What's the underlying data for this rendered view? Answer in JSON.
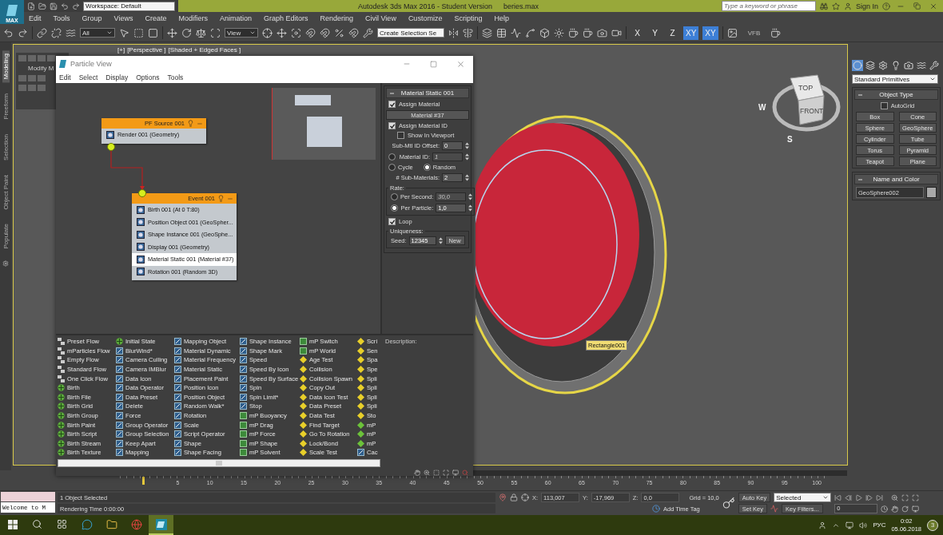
{
  "app": {
    "logo": "MAX",
    "workspace": "Workspace: Default",
    "title": "Autodesk 3ds Max 2016 - Student Version",
    "file": "beries.max",
    "search_placeholder": "Type a keyword or phrase",
    "sign_in": "Sign In"
  },
  "menu": [
    "Edit",
    "Tools",
    "Group",
    "Views",
    "Create",
    "Modifiers",
    "Animation",
    "Graph Editors",
    "Rendering",
    "Civil View",
    "Customize",
    "Scripting",
    "Help"
  ],
  "toolbar": {
    "selection_filter": "All",
    "reference_coordinate": "View",
    "named_selection": "Create Selection Se",
    "axes": [
      {
        "label": "X",
        "selected": false
      },
      {
        "label": "Y",
        "selected": false
      },
      {
        "label": "Z",
        "selected": false
      },
      {
        "label": "XY",
        "selected": true
      },
      {
        "label": "XY",
        "selected": true
      }
    ],
    "vfb": "VFB"
  },
  "ribbon_tabs": [
    {
      "label": "Modeling",
      "selected": true
    },
    {
      "label": "Freeform",
      "selected": false
    },
    {
      "label": "Selection",
      "selected": false
    },
    {
      "label": "Object Paint",
      "selected": false
    },
    {
      "label": "Populate",
      "selected": false
    }
  ],
  "viewport": {
    "active": true,
    "labels": [
      "[+]",
      "[Perspective ]",
      "[Shaded + Edged Faces ]"
    ],
    "mini_panel": "Modify M",
    "object_tag": "Rectangle001",
    "viewcube": {
      "top": "TOP",
      "front": "FRONT",
      "compass": [
        "W",
        "S"
      ]
    }
  },
  "particle_view": {
    "title": "Particle View",
    "menu": [
      "Edit",
      "Select",
      "Display",
      "Options",
      "Tools"
    ],
    "nodes": [
      {
        "title": "PF Source 001",
        "items": [
          {
            "label": "Render 001 (Geometry)",
            "selected": false
          }
        ]
      },
      {
        "title": "Event 001",
        "items": [
          {
            "label": "Birth 001 (At 0 T:80)",
            "selected": false
          },
          {
            "label": "Position Object 001 (GeoSpher...",
            "selected": false
          },
          {
            "label": "Shape Instance 001 (GeoSphe...",
            "selected": false
          },
          {
            "label": "Display 001 (Geometry)",
            "selected": false
          },
          {
            "label": "Material Static 001 (Material #37)",
            "selected": true
          },
          {
            "label": "Rotation 001 (Random 3D)",
            "selected": false
          }
        ]
      }
    ],
    "parameters": {
      "rollout": "Material Static 001",
      "rows": [
        {
          "kind": "checkbox",
          "label": "Assign Material",
          "checked": true
        },
        {
          "kind": "button",
          "label": "Material #37"
        },
        {
          "kind": "checkbox",
          "label": "Assign Material ID",
          "checked": true
        },
        {
          "kind": "subcheckbox",
          "label": "Show In Viewport",
          "checked": false
        },
        {
          "kind": "spinner",
          "label": "Sub-Mtl ID Offset:",
          "value": "0"
        },
        {
          "kind": "radio_spinner",
          "label": "Material ID:",
          "selected": false,
          "disabled": true,
          "value": "1"
        },
        {
          "kind": "radio_pair",
          "options": [
            {
              "label": "Cycle",
              "selected": false
            },
            {
              "label": "Random",
              "selected": true
            }
          ]
        },
        {
          "kind": "spinner",
          "label": "# Sub-Materials:",
          "value": "2"
        },
        {
          "kind": "group",
          "title": "Rate:",
          "rows": [
            {
              "kind": "radio_spinner",
              "label": "Per Second:",
              "selected": false,
              "disabled": true,
              "value": "30,0"
            },
            {
              "kind": "radio_spinner",
              "label": "Per Particle:",
              "selected": true,
              "disabled": false,
              "value": "1,0"
            }
          ]
        },
        {
          "kind": "checkbox",
          "label": "Loop",
          "checked": true
        },
        {
          "kind": "group",
          "title": "Uniqueness:",
          "rows": [
            {
              "kind": "seed",
              "label": "Seed:",
              "value": "12345",
              "button": "New"
            }
          ]
        }
      ]
    },
    "description_label": "Description:",
    "depot": [
      [
        {
          "label": "Preset Flow",
          "kind": "flow"
        },
        {
          "label": "mParticles Flow",
          "kind": "flow"
        },
        {
          "label": "Empty Flow",
          "kind": "flow"
        },
        {
          "label": "Standard Flow",
          "kind": "flow"
        },
        {
          "label": "One Click Flow",
          "kind": "flow"
        },
        {
          "label": "Birth",
          "kind": "birth"
        },
        {
          "label": "Birth File",
          "kind": "birth"
        },
        {
          "label": "Birth Grid",
          "kind": "birth"
        },
        {
          "label": "Birth Group",
          "kind": "birth"
        },
        {
          "label": "Birth Paint",
          "kind": "birth"
        },
        {
          "label": "Birth Script",
          "kind": "birth"
        },
        {
          "label": "Birth Stream",
          "kind": "birth"
        },
        {
          "label": "Birth Texture",
          "kind": "birth"
        }
      ],
      [
        {
          "label": "Initial State",
          "kind": "birth"
        },
        {
          "label": "BlurWind*",
          "kind": "operator"
        },
        {
          "label": "Camera Culling",
          "kind": "operator"
        },
        {
          "label": "Camera IMBlur",
          "kind": "operator"
        },
        {
          "label": "Data Icon",
          "kind": "operator"
        },
        {
          "label": "Data Operator",
          "kind": "operator"
        },
        {
          "label": "Data Preset",
          "kind": "operator"
        },
        {
          "label": "Delete",
          "kind": "operator"
        },
        {
          "label": "Force",
          "kind": "operator"
        },
        {
          "label": "Group Operator",
          "kind": "operator"
        },
        {
          "label": "Group Selection",
          "kind": "operator"
        },
        {
          "label": "Keep Apart",
          "kind": "operator"
        },
        {
          "label": "Mapping",
          "kind": "operator"
        }
      ],
      [
        {
          "label": "Mapping Object",
          "kind": "operator"
        },
        {
          "label": "Material Dynamic",
          "kind": "operator"
        },
        {
          "label": "Material Frequency",
          "kind": "operator"
        },
        {
          "label": "Material Static",
          "kind": "operator"
        },
        {
          "label": "Placement Paint",
          "kind": "operator"
        },
        {
          "label": "Position Icon",
          "kind": "operator"
        },
        {
          "label": "Position Object",
          "kind": "operator"
        },
        {
          "label": "Random Walk*",
          "kind": "operator"
        },
        {
          "label": "Rotation",
          "kind": "operator"
        },
        {
          "label": "Scale",
          "kind": "operator"
        },
        {
          "label": "Script Operator",
          "kind": "operator"
        },
        {
          "label": "Shape",
          "kind": "operator"
        },
        {
          "label": "Shape Facing",
          "kind": "operator"
        }
      ],
      [
        {
          "label": "Shape Instance",
          "kind": "operator"
        },
        {
          "label": "Shape Mark",
          "kind": "operator"
        },
        {
          "label": "Speed",
          "kind": "operator"
        },
        {
          "label": "Speed By Icon",
          "kind": "operator"
        },
        {
          "label": "Speed By Surface",
          "kind": "operator"
        },
        {
          "label": "Spin",
          "kind": "operator"
        },
        {
          "label": "Spin Limit*",
          "kind": "operator"
        },
        {
          "label": "Stop",
          "kind": "operator"
        },
        {
          "label": "mP Buoyancy",
          "kind": "mp"
        },
        {
          "label": "mP Drag",
          "kind": "mp"
        },
        {
          "label": "mP Force",
          "kind": "mp"
        },
        {
          "label": "mP Shape",
          "kind": "mp"
        },
        {
          "label": "mP Solvent",
          "kind": "mp"
        }
      ],
      [
        {
          "label": "mP Switch",
          "kind": "mp"
        },
        {
          "label": "mP World",
          "kind": "mp"
        },
        {
          "label": "Age Test",
          "kind": "test"
        },
        {
          "label": "Collision",
          "kind": "test"
        },
        {
          "label": "Collision Spawn",
          "kind": "test"
        },
        {
          "label": "Copy Out",
          "kind": "test"
        },
        {
          "label": "Data Icon Test",
          "kind": "test"
        },
        {
          "label": "Data Preset",
          "kind": "test"
        },
        {
          "label": "Data Test",
          "kind": "test"
        },
        {
          "label": "Find Target",
          "kind": "test"
        },
        {
          "label": "Go To Rotation",
          "kind": "test"
        },
        {
          "label": "Lock/Bond",
          "kind": "test"
        },
        {
          "label": "Scale Test",
          "kind": "test"
        }
      ],
      [
        {
          "label": "Scri",
          "kind": "test"
        },
        {
          "label": "Sen",
          "kind": "test"
        },
        {
          "label": "Spa",
          "kind": "test"
        },
        {
          "label": "Spe",
          "kind": "test"
        },
        {
          "label": "Spli",
          "kind": "test"
        },
        {
          "label": "Spli",
          "kind": "test"
        },
        {
          "label": "Spli",
          "kind": "test"
        },
        {
          "label": "Spli",
          "kind": "test"
        },
        {
          "label": "Sto",
          "kind": "test"
        },
        {
          "label": "mP",
          "kind": "mptest"
        },
        {
          "label": "mP",
          "kind": "mptest"
        },
        {
          "label": "mP",
          "kind": "mptest"
        },
        {
          "label": "Cac",
          "kind": "operator"
        }
      ]
    ]
  },
  "command_panel": {
    "tabs": [
      {
        "selected": true
      },
      {
        "selected": false
      },
      {
        "selected": false
      },
      {
        "selected": false
      },
      {
        "selected": false
      },
      {
        "selected": false
      },
      {
        "selected": false
      }
    ],
    "category": "Standard Primitives",
    "object_type": {
      "title": "Object Type",
      "autogrid": {
        "label": "AutoGrid",
        "checked": false
      },
      "buttons": [
        "Box",
        "Cone",
        "Sphere",
        "GeoSphere",
        "Cylinder",
        "Tube",
        "Torus",
        "Pyramid",
        "Teapot",
        "Plane"
      ]
    },
    "name_and_color": {
      "title": "Name and Color",
      "name": "GeoSphere002",
      "color": "#a9a9a9"
    }
  },
  "timeline": {
    "ticks": [
      "5",
      "10",
      "15",
      "20",
      "25",
      "30",
      "35",
      "40",
      "45",
      "50",
      "55",
      "60",
      "65",
      "70",
      "75",
      "80",
      "85",
      "90",
      "95",
      "100"
    ]
  },
  "status": {
    "listener_output": "Welcome to M",
    "selection": "1 Object Selected",
    "render_time": "Rendering Time 0:00:00",
    "coords": [
      {
        "label": "X:",
        "value": "113,007"
      },
      {
        "label": "Y:",
        "value": "-17,969"
      },
      {
        "label": "Z:",
        "value": "0,0"
      }
    ],
    "grid": "Grid = 10,0",
    "add_time_tag": "Add Time Tag",
    "auto_key": "Auto Key",
    "key_mode": "Selected",
    "set_key": "Set Key",
    "key_filters": "Key Filters...",
    "frame": "0"
  },
  "taskbar": {
    "apps": [
      {
        "kind": "search",
        "active": false
      },
      {
        "kind": "taskview",
        "active": false
      },
      {
        "kind": "chat",
        "active": false
      },
      {
        "kind": "folder",
        "active": false
      },
      {
        "kind": "browser",
        "active": false
      },
      {
        "kind": "max",
        "active": true
      }
    ],
    "language": "РУС",
    "time": "0:02",
    "date": "05.06.2018",
    "notifications": "3"
  }
}
